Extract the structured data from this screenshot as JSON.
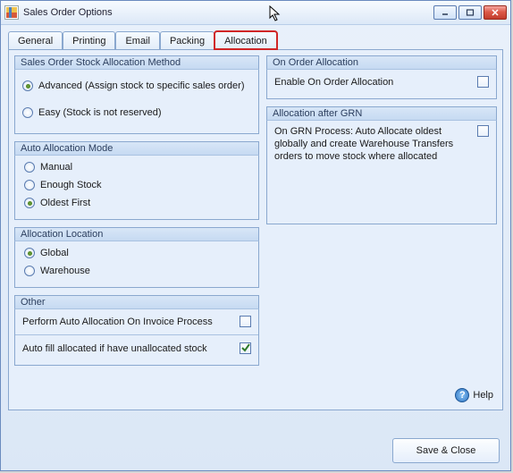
{
  "window": {
    "title": "Sales Order Options"
  },
  "tabs": {
    "general": "General",
    "printing": "Printing",
    "email": "Email",
    "packing": "Packing",
    "allocation": "Allocation"
  },
  "groups": {
    "stock_method": {
      "title": "Sales Order Stock Allocation Method",
      "advanced": "Advanced (Assign stock to specific sales order)",
      "easy": "Easy (Stock is not reserved)",
      "selected": "advanced"
    },
    "auto_mode": {
      "title": "Auto Allocation Mode",
      "manual": "Manual",
      "enough": "Enough Stock",
      "oldest": "Oldest First",
      "selected": "oldest"
    },
    "location": {
      "title": "Allocation Location",
      "global": "Global",
      "warehouse": "Warehouse",
      "selected": "global"
    },
    "other": {
      "title": "Other",
      "invoice": "Perform Auto Allocation On Invoice Process",
      "autofill": "Auto fill allocated if have unallocated stock",
      "invoice_checked": false,
      "autofill_checked": true
    },
    "on_order": {
      "title": "On Order Allocation",
      "enable": "Enable On Order Allocation",
      "enable_checked": false
    },
    "after_grn": {
      "title": "Allocation after GRN",
      "text": "On GRN Process: Auto Allocate oldest globally and create Warehouse Transfers orders to move stock where allocated",
      "checked": false
    }
  },
  "help_label": "Help",
  "save_label": "Save & Close"
}
